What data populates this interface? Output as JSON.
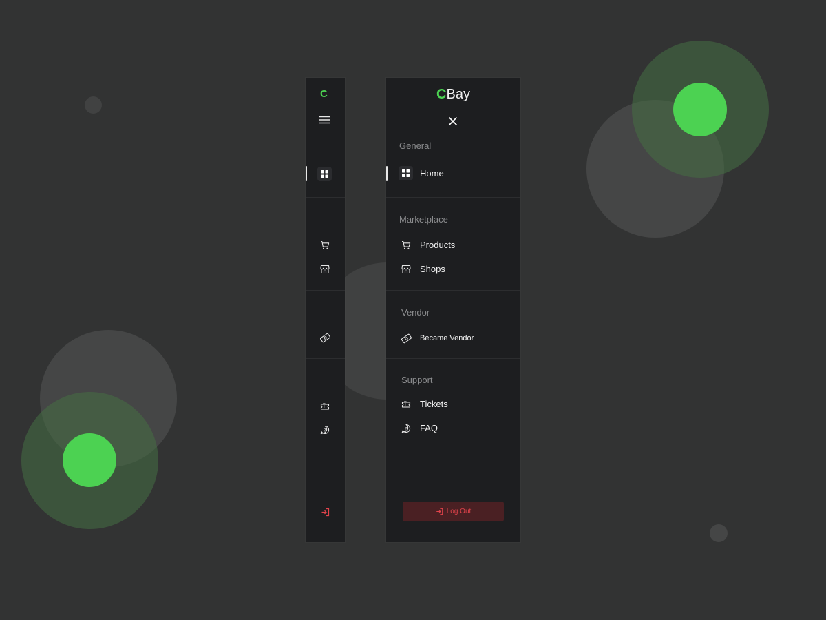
{
  "brand": {
    "short_logo": "C",
    "logo_accent": "C",
    "logo_rest": "Bay",
    "accent_color": "#4cd252"
  },
  "collapsed_sidebar": {
    "menu_icon": "hamburger-icon",
    "items": [
      {
        "icon": "grid-icon",
        "active": true
      },
      {
        "icon": "cart-icon",
        "active": false
      },
      {
        "icon": "store-icon",
        "active": false
      },
      {
        "icon": "money-icon",
        "active": false
      },
      {
        "icon": "ticket-icon",
        "active": false
      },
      {
        "icon": "question-bubble-icon",
        "active": false
      }
    ],
    "logout_icon": "logout-icon"
  },
  "expanded_sidebar": {
    "close_icon": "close-icon",
    "sections": [
      {
        "label": "General",
        "items": [
          {
            "label": "Home",
            "icon": "grid-icon",
            "active": true
          }
        ]
      },
      {
        "label": "Marketplace",
        "items": [
          {
            "label": "Products",
            "icon": "cart-icon"
          },
          {
            "label": "Shops",
            "icon": "store-icon"
          }
        ]
      },
      {
        "label": "Vendor",
        "items": [
          {
            "label": "Became Vendor",
            "icon": "money-icon"
          }
        ]
      },
      {
        "label": "Support",
        "items": [
          {
            "label": "Tickets",
            "icon": "ticket-icon"
          },
          {
            "label": "FAQ",
            "icon": "question-bubble-icon"
          }
        ]
      }
    ],
    "logout_label": "Log Out",
    "logout_color": "#e2434b"
  }
}
